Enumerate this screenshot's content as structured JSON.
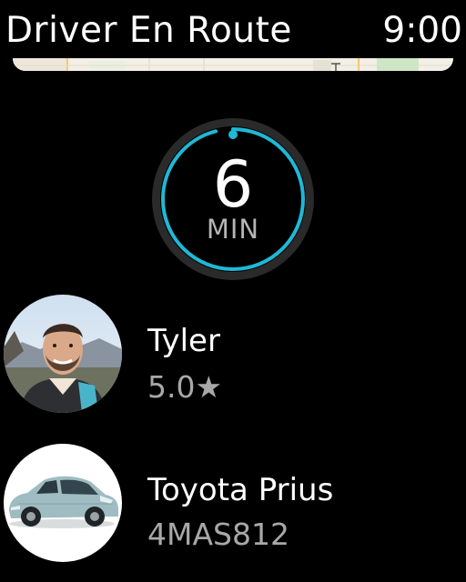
{
  "status_bar": {
    "title": "Driver En Route",
    "time": "9:00"
  },
  "eta": {
    "value": "6",
    "unit": "MIN",
    "progress_fraction": 0.96,
    "accent_color": "#1fb8d6"
  },
  "driver": {
    "name": "Tyler",
    "rating": "5.0",
    "rating_icon": "star-icon"
  },
  "vehicle": {
    "model": "Toyota Prius",
    "plate": "4MAS812"
  }
}
